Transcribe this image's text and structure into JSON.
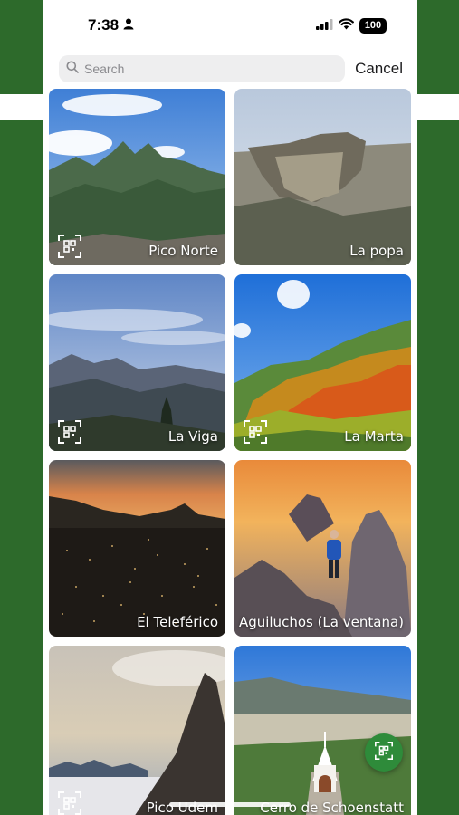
{
  "status_bar": {
    "time": "7:38",
    "battery": "100"
  },
  "search": {
    "placeholder": "Search",
    "value": "",
    "cancel_label": "Cancel"
  },
  "places": [
    {
      "name": "Pico Norte"
    },
    {
      "name": "La popa"
    },
    {
      "name": "La Viga"
    },
    {
      "name": "La Marta"
    },
    {
      "name": "El Teleférico"
    },
    {
      "name": "Aguiluchos (La ventana)"
    },
    {
      "name": "Pico Udem"
    },
    {
      "name": "Cerro de Schoenstatt"
    }
  ],
  "icons": {
    "qr": "qr-scan-icon",
    "search": "search-icon",
    "person": "person-icon",
    "signal": "cellular-signal-icon",
    "wifi": "wifi-icon"
  },
  "colors": {
    "brand_green": "#2d6a2b",
    "fab_green": "#2e8b3a"
  }
}
